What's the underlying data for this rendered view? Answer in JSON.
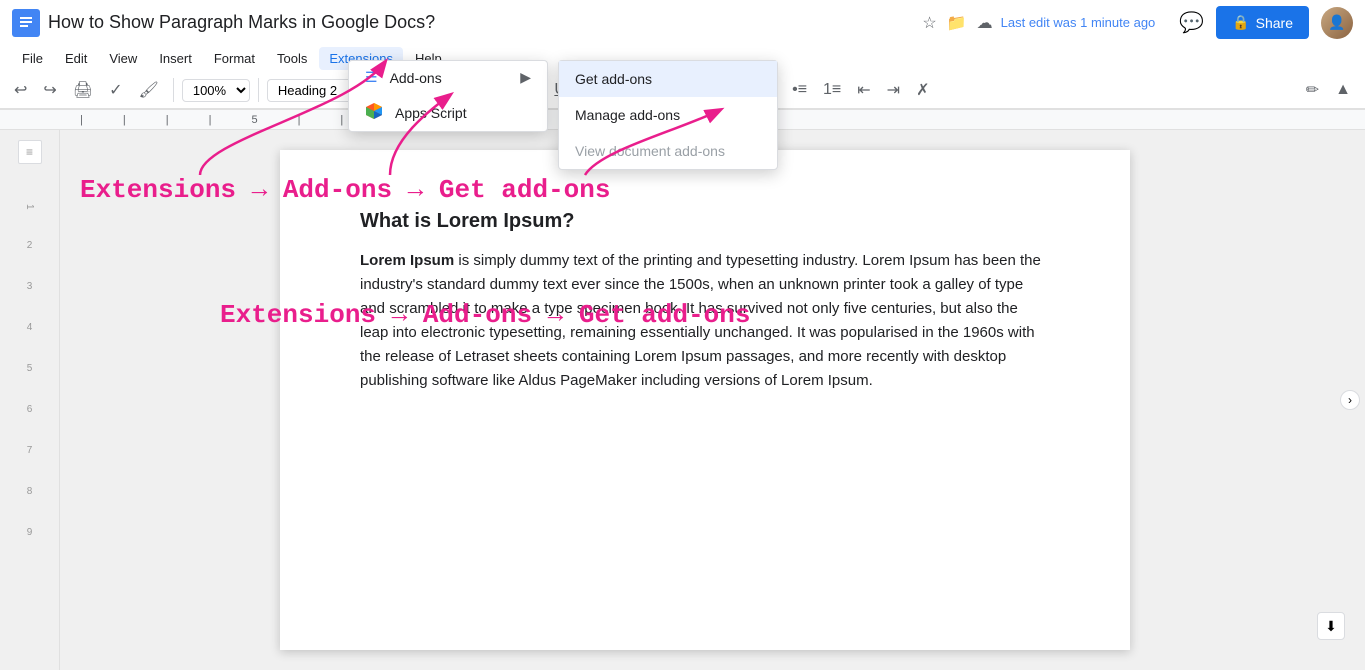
{
  "app": {
    "icon_letter": "≡",
    "title": "How to Show Paragraph Marks in Google Docs?",
    "last_edit": "Last edit was 1 minute ago",
    "share_label": "Share"
  },
  "menu_bar": {
    "items": [
      "File",
      "Edit",
      "View",
      "Insert",
      "Format",
      "Tools",
      "Extensions",
      "Help"
    ]
  },
  "toolbar": {
    "zoom": "100%",
    "heading": "Heading 2"
  },
  "extensions_menu": {
    "items": [
      {
        "label": "Add-ons",
        "has_arrow": true
      },
      {
        "label": "Apps Script",
        "has_arrow": false
      }
    ]
  },
  "addons_menu": {
    "items": [
      {
        "label": "Get add-ons",
        "active": true
      },
      {
        "label": "Manage add-ons",
        "dimmed": false
      },
      {
        "label": "View document add-ons",
        "dimmed": true
      }
    ]
  },
  "annotation": {
    "text": "Extensions → Add-ons → Get add-ons"
  },
  "document": {
    "heading": "What is Lorem Ipsum?",
    "body_bold": "Lorem Ipsum",
    "body_text": " is simply dummy text of the printing and typesetting industry. Lorem Ipsum has been the industry's standard dummy text ever since the 1500s, when an unknown printer took a galley of type and scrambled it to make a type specimen book. It has survived not only five centuries, but also the leap into electronic typesetting, remaining essentially unchanged. It was popularised in the 1960s with the release of Letraset sheets containing Lorem Ipsum passages, and more recently with desktop publishing software like Aldus PageMaker including versions of Lorem Ipsum."
  }
}
